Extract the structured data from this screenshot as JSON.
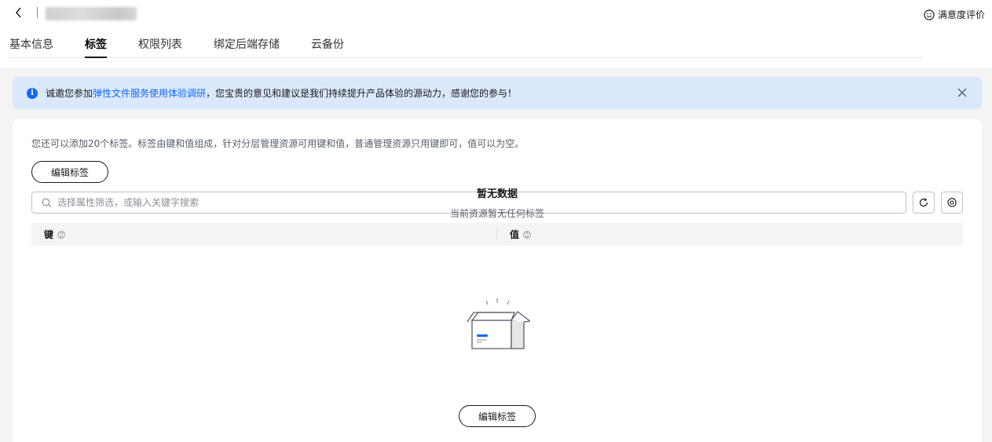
{
  "header": {
    "back_icon": "chevron-left-icon",
    "feedback_icon": "smile-icon",
    "feedback_label": "满意度评价"
  },
  "tabs": [
    {
      "label": "基本信息",
      "active": false
    },
    {
      "label": "标签",
      "active": true
    },
    {
      "label": "权限列表",
      "active": false
    },
    {
      "label": "绑定后端存储",
      "active": false
    },
    {
      "label": "云备份",
      "active": false
    }
  ],
  "notice": {
    "icon": "info-icon",
    "text_prefix": "诚邀您参加",
    "link_text": "弹性文件服务使用体验调研",
    "text_suffix": "，您宝贵的意见和建议是我们持续提升产品体验的源动力，感谢您的参与！",
    "close_icon": "close-icon",
    "accent_color": "#0d68ff"
  },
  "tags": {
    "hint": "您还可以添加20个标签。标签由键和值组成，针对分层管理资源可用键和值，普通管理资源只用键即可，值可以为空。",
    "edit_button_label": "编辑标签",
    "search_placeholder": "选择属性筛选，或输入关键字搜索",
    "search_icon": "search-icon",
    "refresh_icon": "refresh-icon",
    "settings_icon": "gear-icon",
    "columns": [
      {
        "label": "键",
        "sort_icon": "sort-icon"
      },
      {
        "label": "值",
        "sort_icon": "sort-icon"
      }
    ],
    "rows": [],
    "empty": {
      "icon": "empty-box-icon",
      "title": "暂无数据",
      "subtitle": "当前资源暂无任何标签",
      "button_label": "编辑标签"
    }
  }
}
